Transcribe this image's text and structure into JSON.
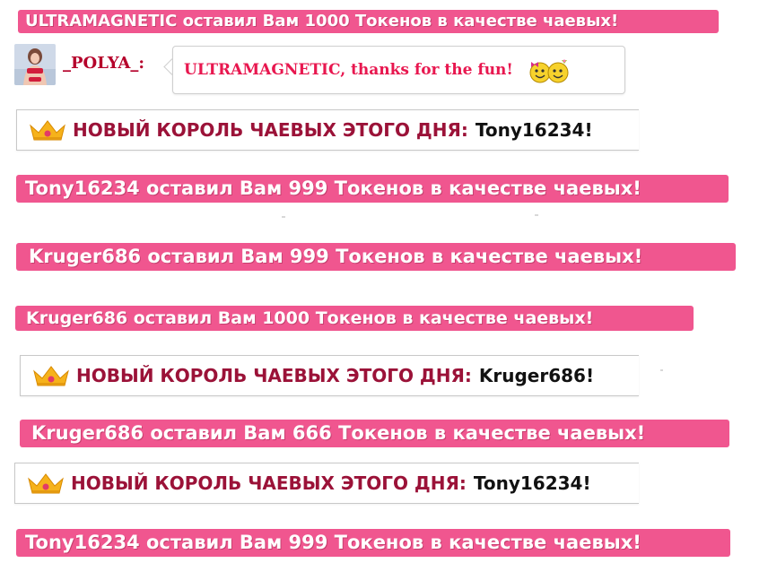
{
  "tip_banners": [
    {
      "text": "ULTRAMAGNETIC оставил Вам 1000 Токенов в качестве чаевых!"
    },
    {
      "text": "Tony16234 оставил Вам 999 Токенов в качестве чаевых!"
    },
    {
      "text": "Kruger686 оставил Вам 999 Токенов в качестве чаевых!"
    },
    {
      "text": "Kruger686 оставил Вам 1000 Токенов в качестве чаевых!"
    },
    {
      "text": "Kruger686 оставил Вам 666 Токенов в качестве чаевых!"
    },
    {
      "text": "Tony16234 оставил Вам 999 Токенов в качестве чаевых!"
    }
  ],
  "chat_message": {
    "username": "_POLYA_:",
    "text": "ULTRAMAGNETIC, thanks for the fun!",
    "emoticon": "two-smileys-icon"
  },
  "king_notices": [
    {
      "label": "НОВЫЙ КОРОЛЬ ЧАЕВЫХ ЭТОГО ДНЯ:",
      "name": "Tony16234!"
    },
    {
      "label": "НОВЫЙ КОРОЛЬ ЧАЕВЫХ ЭТОГО ДНЯ:",
      "name": "Kruger686!"
    },
    {
      "label": "НОВЫЙ КОРОЛЬ ЧАЕВЫХ ЭТОГО ДНЯ:",
      "name": "Tony16234!"
    }
  ],
  "colors": {
    "banner_pink": "#f0568f",
    "king_label": "#9b1238",
    "chat_text": "#e8174f",
    "username": "#b5002a"
  }
}
